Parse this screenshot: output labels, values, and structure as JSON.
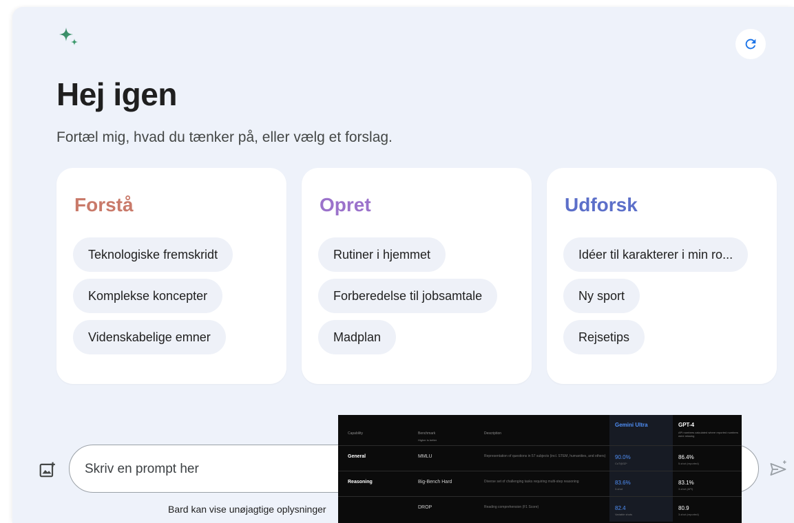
{
  "header": {
    "logo_icon": "sparkle-icon",
    "refresh_icon": "refresh-icon",
    "greeting": "Hej igen",
    "subtitle": "Fortæl mig, hvad du tænker på, eller vælg et forslag."
  },
  "colors": {
    "background": "#eef2fa",
    "card": "#ffffff",
    "chip": "#eef1f8",
    "forsta": "#c97a6a",
    "opret": "#9b72cb",
    "udforsk": "#5c6fc9",
    "accent_blue": "#1a73e8"
  },
  "cards": [
    {
      "title": "Forstå",
      "chips": [
        "Teknologiske fremskridt",
        "Komplekse koncepter",
        "Videnskabelige emner"
      ]
    },
    {
      "title": "Opret",
      "chips": [
        "Rutiner i hjemmet",
        "Forberedelse til jobsamtale",
        "Madplan"
      ]
    },
    {
      "title": "Udforsk",
      "chips": [
        "Idéer til karakterer i min ro...",
        "Ny sport",
        "Rejsetips"
      ]
    }
  ],
  "prompt": {
    "placeholder": "Skriv en prompt her",
    "upload_icon": "image-upload-icon",
    "send_icon": "send-icon"
  },
  "disclaimer": "Bard kan vise unøjagtige oplysninger",
  "overlay_table": {
    "headers": {
      "capability": "Capability",
      "benchmark": "Benchmark",
      "benchmark_sub": "Higher is better",
      "description": "Description",
      "gemini": "Gemini Ultra",
      "gpt": "GPT-4",
      "gpt_sub": "API numbers calculated where reported numbers were missing"
    },
    "rows": [
      {
        "capability": "General",
        "benchmark": "MMLU",
        "description": "Representation of questions in 57 subjects (incl. STEM, humanities, and others)",
        "gemini": "90.0%",
        "gemini_note": "CoT@32*",
        "gpt": "86.4%",
        "gpt_note": "5-shot (reported)"
      },
      {
        "capability": "Reasoning",
        "benchmark": "Big-Bench Hard",
        "description": "Diverse set of challenging tasks requiring multi-step reasoning",
        "gemini": "83.6%",
        "gemini_note": "3-shot",
        "gpt": "83.1%",
        "gpt_note": "3-shot (API)"
      },
      {
        "capability": "",
        "benchmark": "DROP",
        "description": "Reading comprehension (F1 Score)",
        "gemini": "82.4",
        "gemini_note": "Variable shots",
        "gpt": "80.9",
        "gpt_note": "3-shot (reported)"
      }
    ]
  }
}
